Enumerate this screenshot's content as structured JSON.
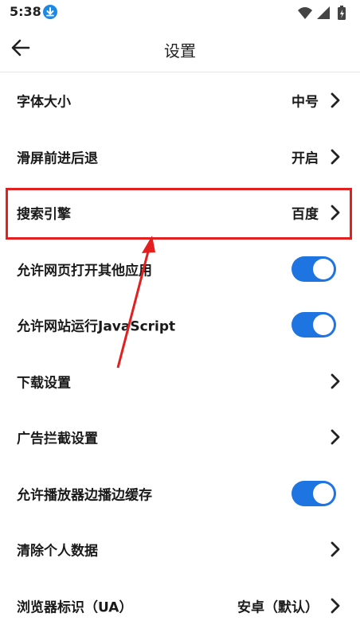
{
  "status_bar": {
    "time": "5:38",
    "download_icon": "download-icon",
    "wifi_icon": "wifi-icon",
    "signal_icon": "signal-icon",
    "battery_icon": "battery-charging-icon"
  },
  "app_bar": {
    "back_icon": "arrow-left-icon",
    "title": "设置"
  },
  "settings": {
    "font_size": {
      "label": "字体大小",
      "value": "中号"
    },
    "swipe_nav": {
      "label": "滑屏前进后退",
      "value": "开启"
    },
    "search_engine": {
      "label": "搜索引擎",
      "value": "百度"
    },
    "allow_open_apps": {
      "label": "允许网页打开其他应用",
      "enabled": true
    },
    "allow_javascript": {
      "label": "允许网站运行JavaScript",
      "enabled": true
    },
    "download_settings": {
      "label": "下载设置"
    },
    "adblock_settings": {
      "label": "广告拦截设置"
    },
    "player_cache": {
      "label": "允许播放器边播边缓存",
      "enabled": true
    },
    "clear_data": {
      "label": "清除个人数据"
    },
    "user_agent": {
      "label": "浏览器标识（UA）",
      "value": "安卓（默认）"
    }
  },
  "colors": {
    "accent": "#1e74e0",
    "highlight": "#e41f1f",
    "text": "#1a1a1a"
  }
}
